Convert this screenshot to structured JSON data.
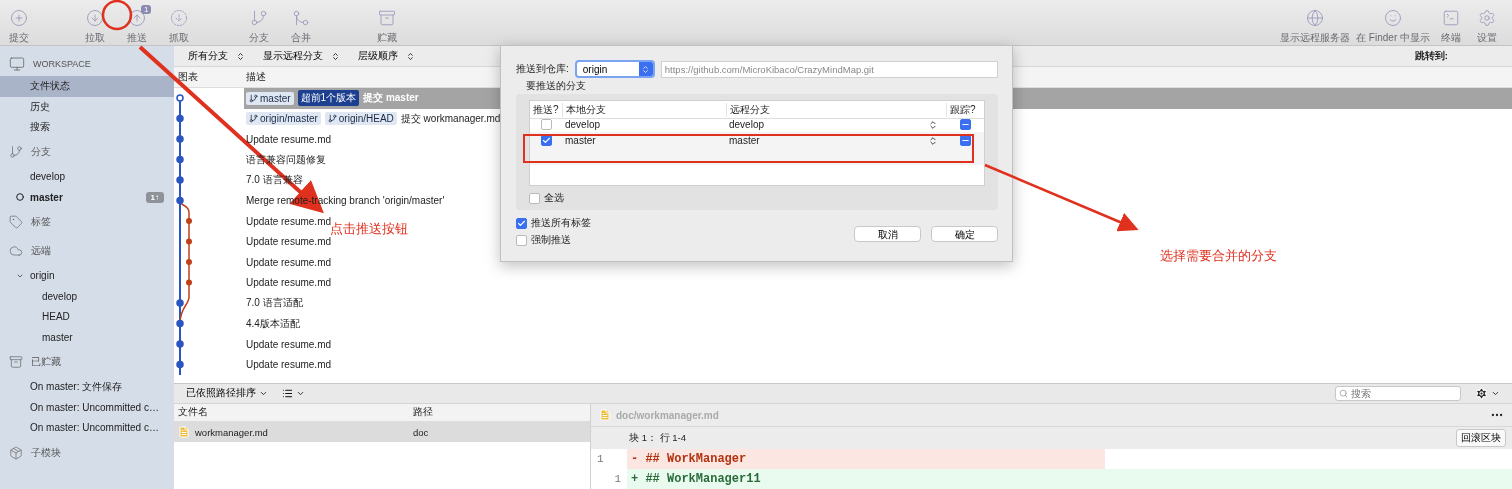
{
  "toolbar": {
    "left": [
      {
        "kind": "commit",
        "label": "提交"
      },
      {
        "kind": "pull",
        "label": "拉取"
      },
      {
        "kind": "push",
        "label": "推送",
        "badge": "1"
      },
      {
        "kind": "fetch",
        "label": "抓取"
      },
      {
        "kind": "branch",
        "label": "分支"
      },
      {
        "kind": "merge",
        "label": "合并"
      },
      {
        "kind": "stash",
        "label": "贮藏"
      }
    ],
    "right": [
      {
        "kind": "remote",
        "label": "显示远程服务器"
      },
      {
        "kind": "finder",
        "label": "在 Finder 中显示"
      },
      {
        "kind": "terminal",
        "label": "终端"
      },
      {
        "kind": "settings",
        "label": "设置"
      }
    ]
  },
  "sidebar": {
    "sections": [
      {
        "kind": "workspace",
        "title": "WORKSPACE",
        "items": [
          {
            "label": "文件状态",
            "selected": true,
            "current": false
          },
          {
            "label": "历史",
            "selected": false,
            "current": false
          },
          {
            "label": "搜索",
            "selected": false,
            "current": false
          }
        ]
      },
      {
        "kind": "branch",
        "title": "分支",
        "items": [
          {
            "label": "develop",
            "selected": false,
            "current": false
          },
          {
            "label": "master",
            "selected": false,
            "current": true,
            "badge": "1↑"
          }
        ]
      },
      {
        "kind": "tag",
        "title": "标签"
      },
      {
        "kind": "remote",
        "title": "远端",
        "items": [
          {
            "label": "origin",
            "selected": false,
            "current": false,
            "expanded": true,
            "children": [
              {
                "label": "develop",
                "selected": false,
                "current": false
              },
              {
                "label": "HEAD",
                "selected": false,
                "current": false
              },
              {
                "label": "master",
                "selected": false,
                "current": false
              }
            ]
          }
        ]
      },
      {
        "kind": "stash",
        "title": "已贮藏",
        "items": [
          {
            "label": "On master: 文件保存",
            "selected": false,
            "current": false
          },
          {
            "label": "On master: Uncommitted c…",
            "selected": false,
            "current": false
          },
          {
            "label": "On master: Uncommitted c…",
            "selected": false,
            "current": false
          }
        ]
      },
      {
        "kind": "submodule",
        "title": "子模块"
      }
    ]
  },
  "filters": [
    {
      "label": "所有分支"
    },
    {
      "label": "显示远程分支"
    },
    {
      "label": "层级顺序"
    }
  ],
  "jump": {
    "label": "跳转到:"
  },
  "commits": {
    "columns": [
      "图表",
      "描述"
    ],
    "rows": [
      {
        "refs": [
          {
            "kind": "local",
            "label": "master"
          },
          {
            "kind": "ahead",
            "label": "超前1个版本"
          }
        ],
        "message": "提交 master",
        "selected": true
      },
      {
        "refs": [
          {
            "kind": "remote",
            "label": "origin/master"
          },
          {
            "kind": "remote",
            "label": "origin/HEAD"
          }
        ],
        "message": "提交 workmanager.md",
        "selected": false
      },
      {
        "message": "Update resume.md",
        "selected": false
      },
      {
        "message": "语言兼容问题修复",
        "selected": false
      },
      {
        "message": "7.0 语言兼容",
        "selected": false
      },
      {
        "message": "Merge remote-tracking branch 'origin/master'",
        "selected": false
      },
      {
        "message": "Update resume.md",
        "selected": false
      },
      {
        "message": "Update resume.md",
        "selected": false
      },
      {
        "message": "Update resume.md",
        "selected": false
      },
      {
        "message": "Update resume.md",
        "selected": false
      },
      {
        "message": "7.0 语言适配",
        "selected": false
      },
      {
        "message": "4.4版本适配",
        "selected": false
      },
      {
        "message": "Update resume.md",
        "selected": false
      },
      {
        "message": "Update resume.md",
        "selected": false
      }
    ]
  },
  "push_dialog": {
    "repo_label": "推送到仓库:",
    "remote": "origin",
    "url": "https://github.com/MicroKibaco/CrazyMindMap.git",
    "section": "要推送的分支",
    "columns": [
      "推送?",
      "本地分支",
      "远程分支",
      "跟踪?"
    ],
    "rows": [
      {
        "checked": false,
        "local": "develop",
        "remote": "develop",
        "tracked": true
      },
      {
        "checked": true,
        "local": "master",
        "remote": "master",
        "tracked": true
      }
    ],
    "select_all": {
      "label": "全选",
      "checked": false
    },
    "options": [
      {
        "label": "推送所有标签",
        "checked": true
      },
      {
        "label": "强制推送",
        "checked": false
      }
    ],
    "buttons": [
      "取消",
      "确定"
    ]
  },
  "files": {
    "sort": "已依照路径排序",
    "search": {
      "placeholder": "搜索"
    },
    "columns": [
      "文件名",
      "路径"
    ],
    "rows": [
      {
        "name": "workmanager.md",
        "path": "doc",
        "selected": true
      }
    ]
  },
  "diff": {
    "file": "doc/workmanager.md",
    "hunk": "块 1： 行 1-4",
    "revert": "回滚区块",
    "lines": [
      {
        "kind": "removed",
        "old": "1",
        "text": "- ## WorkManager"
      },
      {
        "kind": "added",
        "new": "1",
        "text": "+ ## WorkManager11"
      }
    ]
  },
  "annotations": {
    "labels": [
      {
        "text": "点击推送按钮"
      },
      {
        "text": "选择需要合并的分支"
      }
    ]
  }
}
